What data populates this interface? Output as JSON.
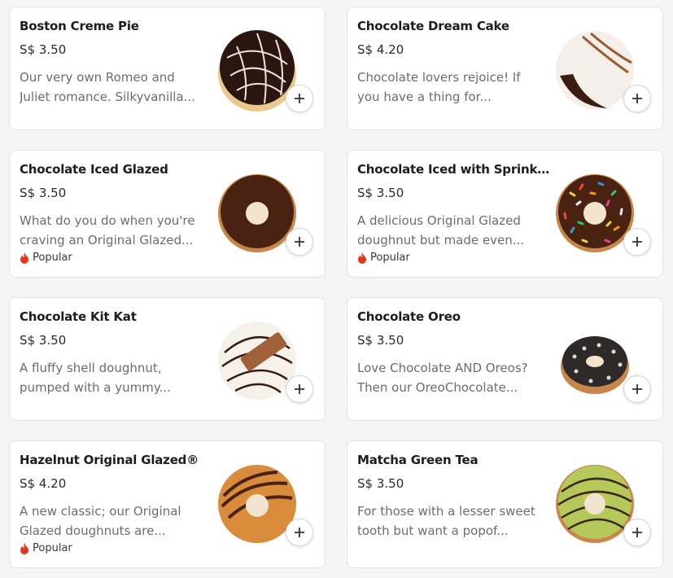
{
  "items": [
    {
      "name": "Boston Creme Pie",
      "price": "S$ 3.50",
      "desc1": "Our very own Romeo and",
      "desc2": "Juliet romance. Silkyvanilla...",
      "badge": ""
    },
    {
      "name": "Chocolate Dream Cake",
      "price": "S$ 4.20",
      "desc1": "Chocolate lovers rejoice! If",
      "desc2": "you have a thing for...",
      "badge": ""
    },
    {
      "name": "Chocolate Iced Glazed",
      "price": "S$ 3.50",
      "desc1": "What do you do when you're",
      "desc2": "craving an Original Glazed...",
      "badge": "Popular"
    },
    {
      "name": "Chocolate Iced with Sprinkl...",
      "price": "S$ 3.50",
      "desc1": "A delicious Original Glazed",
      "desc2": "doughnut but made even...",
      "badge": "Popular"
    },
    {
      "name": "Chocolate Kit Kat",
      "price": "S$ 3.50",
      "desc1": "A fluffy shell doughnut,",
      "desc2": "pumped with a yummy...",
      "badge": ""
    },
    {
      "name": "Chocolate Oreo",
      "price": "S$ 3.50",
      "desc1": "Love Chocolate AND Oreos?",
      "desc2": "Then our OreoChocolate...",
      "badge": ""
    },
    {
      "name": "Hazelnut Original Glazed®",
      "price": "S$ 4.20",
      "desc1": "A new classic; our Original",
      "desc2": "Glazed doughnuts are...",
      "badge": "Popular"
    },
    {
      "name": "Matcha Green Tea",
      "price": "S$ 3.50",
      "desc1": "For those with a lesser sweet",
      "desc2": "tooth but want a popof...",
      "badge": ""
    }
  ],
  "icons": {
    "add": "plus-icon",
    "popular": "flame-icon"
  },
  "colors": {
    "flame": "#e2361c",
    "card_border": "#e2e2e2"
  }
}
